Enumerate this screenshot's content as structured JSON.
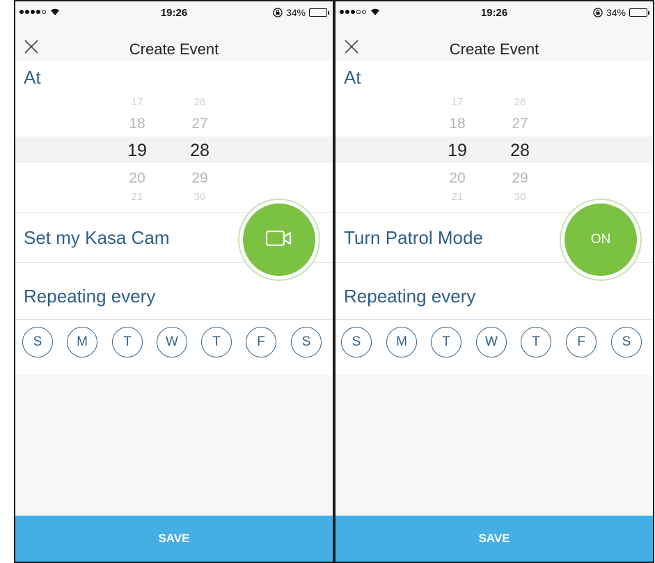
{
  "colors": {
    "accent_blue": "#45aee3",
    "label_blue": "#2f5f86",
    "action_green": "#7cc242"
  },
  "left": {
    "status": {
      "time": "19:26",
      "battery": "34%",
      "battery_level": 0.34,
      "signal_filled": 4,
      "signal_total": 5
    },
    "nav": {
      "title": "Create Event",
      "close_icon": "close-icon"
    },
    "at_label": "At",
    "picker": {
      "hours": [
        "17",
        "18",
        "19",
        "20",
        "21"
      ],
      "minutes": [
        "26",
        "27",
        "28",
        "29",
        "30"
      ]
    },
    "action": {
      "label": "Set my Kasa Cam",
      "button_icon": "video-camera-icon"
    },
    "repeat_label": "Repeating every",
    "days": [
      "S",
      "M",
      "T",
      "W",
      "T",
      "F",
      "S"
    ],
    "save_label": "SAVE"
  },
  "right": {
    "status": {
      "time": "19:26",
      "battery": "34%",
      "battery_level": 0.34,
      "signal_filled": 3,
      "signal_total": 5
    },
    "nav": {
      "title": "Create Event",
      "close_icon": "close-icon"
    },
    "at_label": "At",
    "picker": {
      "hours": [
        "17",
        "18",
        "19",
        "20",
        "21"
      ],
      "minutes": [
        "26",
        "27",
        "28",
        "29",
        "30"
      ]
    },
    "action": {
      "label": "Turn Patrol Mode",
      "button_text": "ON"
    },
    "repeat_label": "Repeating every",
    "days": [
      "S",
      "M",
      "T",
      "W",
      "T",
      "F",
      "S"
    ],
    "save_label": "SAVE"
  }
}
